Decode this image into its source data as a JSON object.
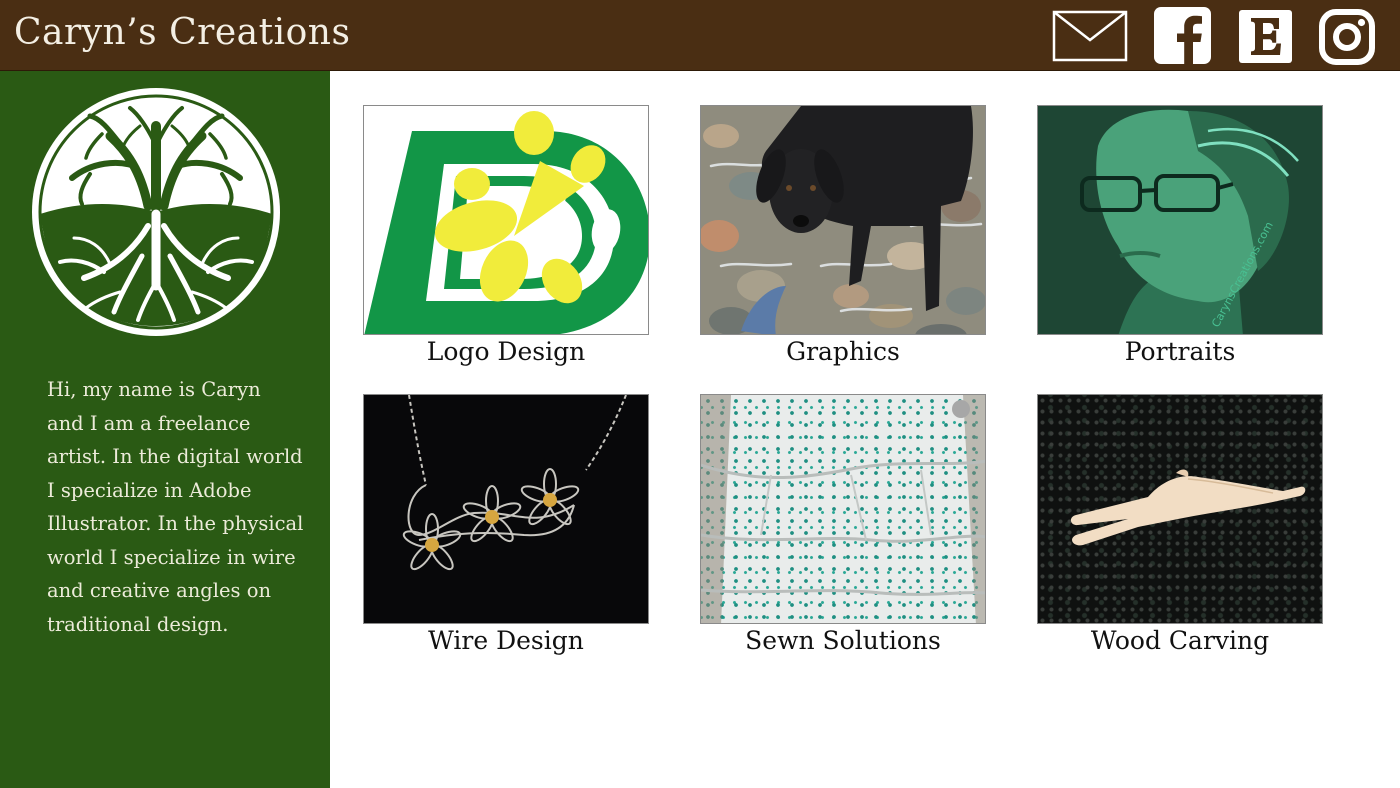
{
  "header": {
    "title": "Caryn’s Creations",
    "background_color": "#4a2e13",
    "social_links": [
      {
        "icon": "mail-icon"
      },
      {
        "icon": "facebook-icon"
      },
      {
        "icon": "etsy-icon"
      },
      {
        "icon": "instagram-icon"
      }
    ]
  },
  "sidebar": {
    "background_color": "#2a5a14",
    "logo_icon": "tree-of-life-icon",
    "bio_lines": [
      "Hi, my name is Caryn",
      "and I am a freelance",
      "artist. In the digital world",
      "I specialize in Adobe",
      "Illustrator. In the physical",
      "world I specialize in wire",
      "and creative angles on",
      "traditional design."
    ]
  },
  "gallery": {
    "items": [
      {
        "label": "Logo Design",
        "image": "logo-design-thumbnail"
      },
      {
        "label": "Graphics",
        "image": "graphics-thumbnail"
      },
      {
        "label": "Portraits",
        "image": "portraits-thumbnail",
        "watermark": "CarynsCreations.com"
      },
      {
        "label": "Wire Design",
        "image": "wire-design-thumbnail"
      },
      {
        "label": "Sewn Solutions",
        "image": "sewn-solutions-thumbnail"
      },
      {
        "label": "Wood Carving",
        "image": "wood-carving-thumbnail"
      }
    ]
  }
}
